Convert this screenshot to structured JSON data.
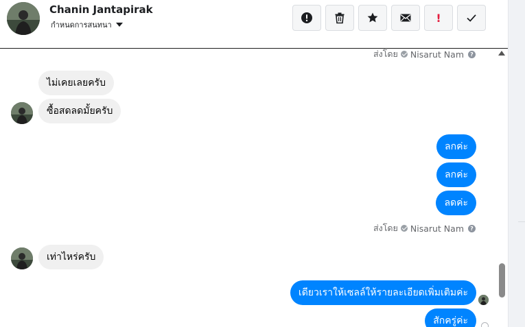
{
  "header": {
    "contact_name": "Chanin Jantapirak",
    "conversation_settings": "กำหนดการสนทนา",
    "toolbar": [
      {
        "name": "spam-button",
        "icon": "alert-circle-icon"
      },
      {
        "name": "delete-button",
        "icon": "trash-icon"
      },
      {
        "name": "star-button",
        "icon": "star-icon"
      },
      {
        "name": "mark-unread-button",
        "icon": "envelope-icon"
      },
      {
        "name": "important-button",
        "icon": "exclamation-icon",
        "label": "!"
      },
      {
        "name": "mark-done-button",
        "icon": "checkmark-icon"
      }
    ]
  },
  "sent_by": {
    "prefix": "ส่งโดย",
    "sender": "Nisarut Nam"
  },
  "messages": {
    "m1": "ไม่เคยเลยครับ",
    "m2": "ซื้อสดลดมั้ยครับ",
    "m3": "ลกค่ะ",
    "m4": "ลกค่ะ",
    "m5": "ลดค่ะ",
    "m6": "เท่าไหร่ครับ",
    "m7": "เดียวเราให้เซลล์ให้รายละเอียดเพิ่มเติมค่ะ",
    "m8": "สักครู่ค่ะ"
  },
  "colors": {
    "outgoing_bubble": "#0084ff",
    "incoming_bubble": "#f0f0f0",
    "important_red": "#e41e3f"
  }
}
